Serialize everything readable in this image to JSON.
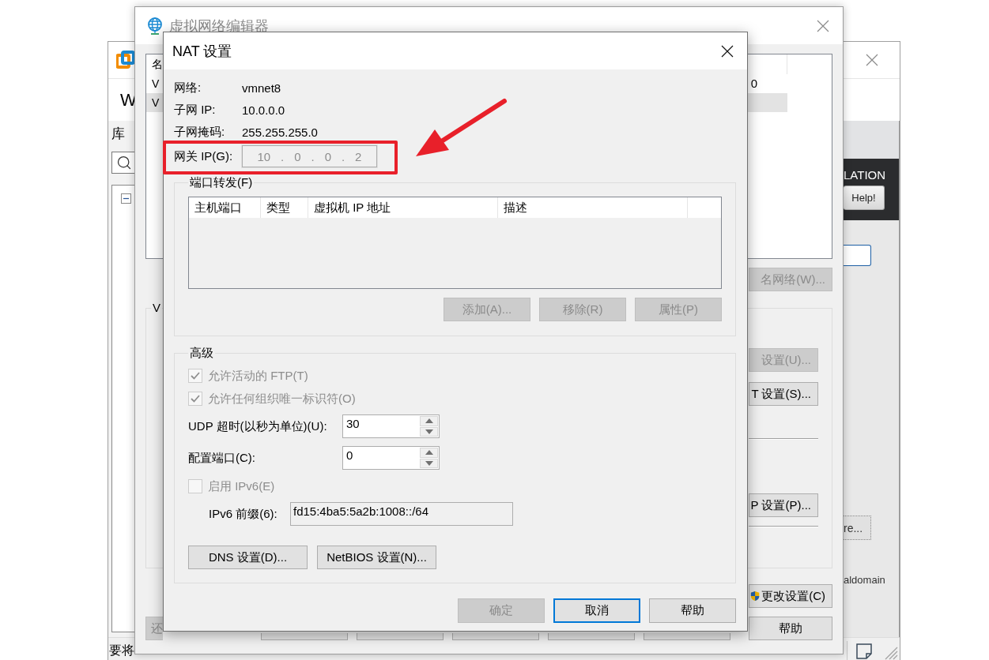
{
  "vmware_window": {
    "title_fragment": "W",
    "sidebar_title": "库",
    "banner_fragment": "LATION",
    "help_button": "Help!",
    "button_fragment": "re...",
    "domain_fragment": "aldomain",
    "status_fragment": "要将"
  },
  "network_editor": {
    "title": "虚拟网络编辑器",
    "header_fragment": "名",
    "rows": [
      {
        "name_fragment": "V",
        "value_fragment": "0",
        "selected": false
      },
      {
        "name_fragment": "V",
        "selected": true
      }
    ],
    "rename_button": {
      "label": "名网络(W)...",
      "disabled": true
    },
    "group_fragment": "V",
    "side_buttons": [
      {
        "label": "设置(U)...",
        "disabled": true
      },
      {
        "label": "T 设置(S)...",
        "disabled": false
      },
      {
        "label": "P 设置(P)...",
        "disabled": false
      }
    ],
    "change_settings_button": "更改设置(C)",
    "restore_button": {
      "label": "还",
      "disabled": true
    },
    "help_button": "帮助"
  },
  "nat_dialog": {
    "title": "NAT 设置",
    "info": [
      {
        "label": "网络:",
        "value": "vmnet8"
      },
      {
        "label": "子网 IP:",
        "value": "10.0.0.0"
      },
      {
        "label": "子网掩码:",
        "value": "255.255.255.0"
      }
    ],
    "gateway": {
      "label": "网关 IP(G):",
      "octets": [
        "10",
        "0",
        "0",
        "2"
      ],
      "separator": ".",
      "disabled": true
    },
    "port_forwarding": {
      "title": "端口转发(F)",
      "columns": [
        "主机端口",
        "类型",
        "虚拟机 IP 地址",
        "描述"
      ],
      "buttons": [
        {
          "label": "添加(A)...",
          "disabled": true
        },
        {
          "label": "移除(R)",
          "disabled": true
        },
        {
          "label": "属性(P)",
          "disabled": true
        }
      ]
    },
    "advanced": {
      "title": "高级",
      "options": [
        {
          "label": "允许活动的 FTP(T)",
          "checked": true,
          "disabled": true
        },
        {
          "label": "允许任何组织唯一标识符(O)",
          "checked": true,
          "disabled": true
        }
      ],
      "udp_timeout": {
        "label": "UDP 超时(以秒为单位)(U):",
        "value": "30"
      },
      "config_port": {
        "label": "配置端口(C):",
        "value": "0"
      },
      "ipv6": {
        "label": "启用 IPv6(E)",
        "checked": false,
        "disabled": true
      },
      "ipv6_prefix": {
        "label": "IPv6 前缀(6):",
        "value": "fd15:4ba5:5a2b:1008::/64"
      },
      "buttons": [
        "DNS 设置(D)...",
        "NetBIOS 设置(N)..."
      ]
    },
    "footer_buttons": [
      {
        "label": "确定",
        "disabled": true,
        "focused": false
      },
      {
        "label": "取消",
        "disabled": false,
        "focused": true
      },
      {
        "label": "帮助",
        "disabled": false,
        "focused": false
      }
    ]
  }
}
